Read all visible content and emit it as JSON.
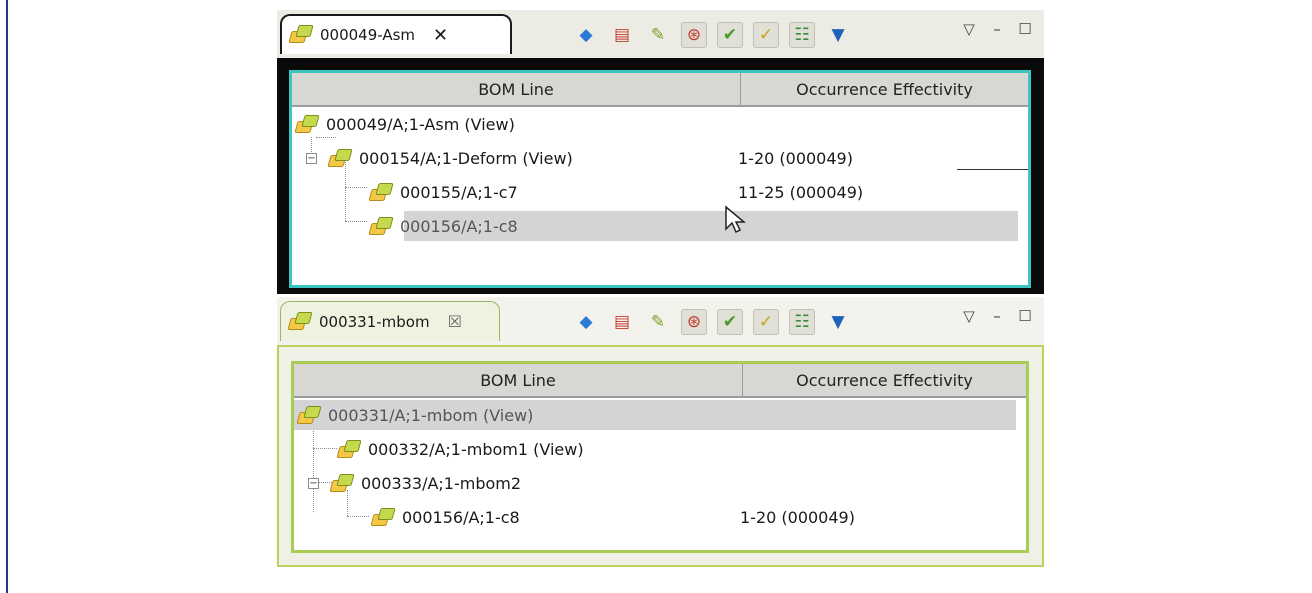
{
  "panel_top": {
    "tab_label": "000049-Asm",
    "tab_close": "✕",
    "columns": [
      "BOM Line",
      "Occurrence Effectivity"
    ],
    "rows": [
      {
        "name": "000049/A;1-Asm (View)",
        "effectivity": ""
      },
      {
        "name": "000154/A;1-Deform (View)",
        "effectivity": "1-20 (000049)"
      },
      {
        "name": "000155/A;1-c7",
        "effectivity": "11-25 (000049)"
      },
      {
        "name": "000156/A;1-c8",
        "effectivity": ""
      }
    ],
    "border_color": "#3bc4c0"
  },
  "panel_bottom": {
    "tab_label": "000331-mbom",
    "tab_close": "☒",
    "columns": [
      "BOM Line",
      "Occurrence Effectivity"
    ],
    "rows": [
      {
        "name": "000331/A;1-mbom (View)",
        "effectivity": ""
      },
      {
        "name": "000332/A;1-mbom1 (View)",
        "effectivity": ""
      },
      {
        "name": "000333/A;1-mbom2",
        "effectivity": ""
      },
      {
        "name": "000156/A;1-c8",
        "effectivity": "1-20 (000049)"
      }
    ],
    "border_color": "#a9cc55"
  },
  "toolbar_icons": [
    "assembly-icon",
    "info-icon",
    "edit-icon",
    "revision-rule-icon",
    "check-icon",
    "effectivity-icon",
    "variant-icon",
    "filter-icon"
  ],
  "window_controls": {
    "menu": "▽",
    "minimize": "–",
    "maximize": "☐"
  }
}
